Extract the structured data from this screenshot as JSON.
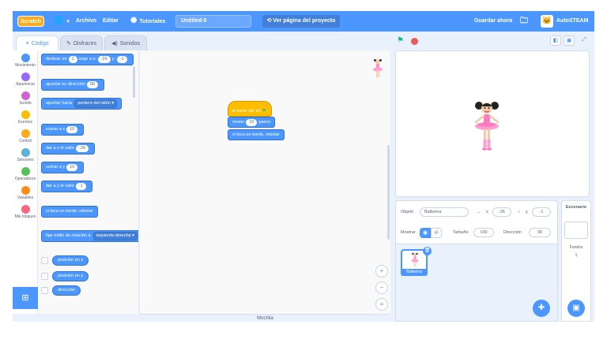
{
  "menubar": {
    "logo": "Scratch",
    "archivo": "Archivo",
    "editar": "Editar",
    "tutoriales": "Tutoriales",
    "project_name": "Untitled-5",
    "see_project": "Ver página del proyecto",
    "save_now": "Guardar ahora",
    "user": "AutoSTEAM"
  },
  "tabs": {
    "code": "Código",
    "costumes": "Disfraces",
    "sounds": "Sonidos"
  },
  "categories": [
    {
      "label": "Movimiento",
      "color": "#4c97ff"
    },
    {
      "label": "Apariencia",
      "color": "#9966ff"
    },
    {
      "label": "Sonido",
      "color": "#cf63cf"
    },
    {
      "label": "Eventos",
      "color": "#ffbf00"
    },
    {
      "label": "Control",
      "color": "#ffab19"
    },
    {
      "label": "Sensores",
      "color": "#5cb1d6"
    },
    {
      "label": "Operadores",
      "color": "#59c059"
    },
    {
      "label": "Variables",
      "color": "#ff8c1a"
    },
    {
      "label": "Mis bloques",
      "color": "#ff6680"
    }
  ],
  "palette": {
    "glide_prefix": "deslizar en",
    "glide_secs": "1",
    "glide_mid": "segs a x:",
    "glide_x": "-26",
    "glide_y_label": "y:",
    "glide_y": "-1",
    "point_dir": "apuntar en dirección",
    "point_dir_val": "90",
    "point_towards": "apuntar hacia",
    "point_towards_val": "puntero del ratón",
    "change_x": "sumar a x",
    "change_x_val": "10",
    "set_x": "dar a x el valor",
    "set_x_val": "-26",
    "change_y": "sumar a y",
    "change_y_val": "10",
    "set_y": "dar a y el valor",
    "set_y_val": "-1",
    "bounce": "si toca un borde, rebotar",
    "rotation": "fijar estilo de rotación a",
    "rotation_val": "izquierda-derecha",
    "pos_x": "posición en x",
    "pos_y": "posición en y",
    "direction": "dirección"
  },
  "script": {
    "hat": "al hacer clic en",
    "move_prefix": "mover",
    "move_val": "10",
    "move_suffix": "pasos",
    "bounce": "si toca un borde, rebotar"
  },
  "mochila": "Mochila",
  "sprite_info": {
    "object_label": "Objeto",
    "object_name": "Ballerina",
    "x_label": "x",
    "x_val": "-26",
    "y_label": "y",
    "y_val": "-1",
    "show_label": "Mostrar",
    "size_label": "Tamaño",
    "size_val": "100",
    "dir_label": "Dirección",
    "dir_val": "90"
  },
  "sprites": [
    {
      "name": "Ballerina"
    }
  ],
  "stage_panel": {
    "title": "Escenario",
    "backdrops_label": "Fondos",
    "backdrops_count": "1"
  },
  "colors": {
    "accent": "#4c97ff",
    "events": "#ffbf00",
    "flag": "#0fbd8c",
    "stop": "#ec5959"
  }
}
